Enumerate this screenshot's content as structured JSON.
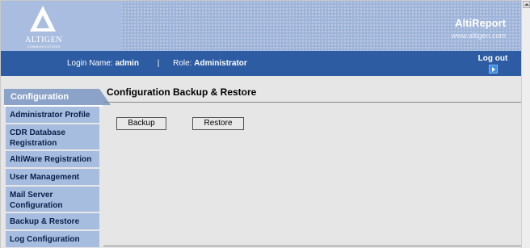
{
  "brand": {
    "logo_text": "ALTIGEN",
    "logo_subtext": "COMMUNICATIONS",
    "app_name": "AltiReport",
    "url": "www.altigen.com"
  },
  "userbar": {
    "login_label": "Login Name:",
    "login_value": "admin",
    "separator": "|",
    "role_label": "Role:",
    "role_value": "Administrator",
    "logout_label": "Log out"
  },
  "nav": {
    "section_tab": "Configuration",
    "items": [
      {
        "label": "Administrator Profile"
      },
      {
        "label": "CDR Database Registration"
      },
      {
        "label": "AltiWare Registration"
      },
      {
        "label": "User Management"
      },
      {
        "label": "Mail Server Configuration"
      },
      {
        "label": "Backup & Restore"
      },
      {
        "label": "Log Configuration"
      }
    ]
  },
  "main": {
    "title": "Configuration Backup & Restore",
    "backup_label": "Backup",
    "restore_label": "Restore"
  },
  "colors": {
    "banner": "#9fb4d9",
    "userbar": "#2d5ca3",
    "nav_item": "#a7bde0",
    "nav_tab": "#8ba3c8",
    "content_bg": "#e6e6e6"
  }
}
